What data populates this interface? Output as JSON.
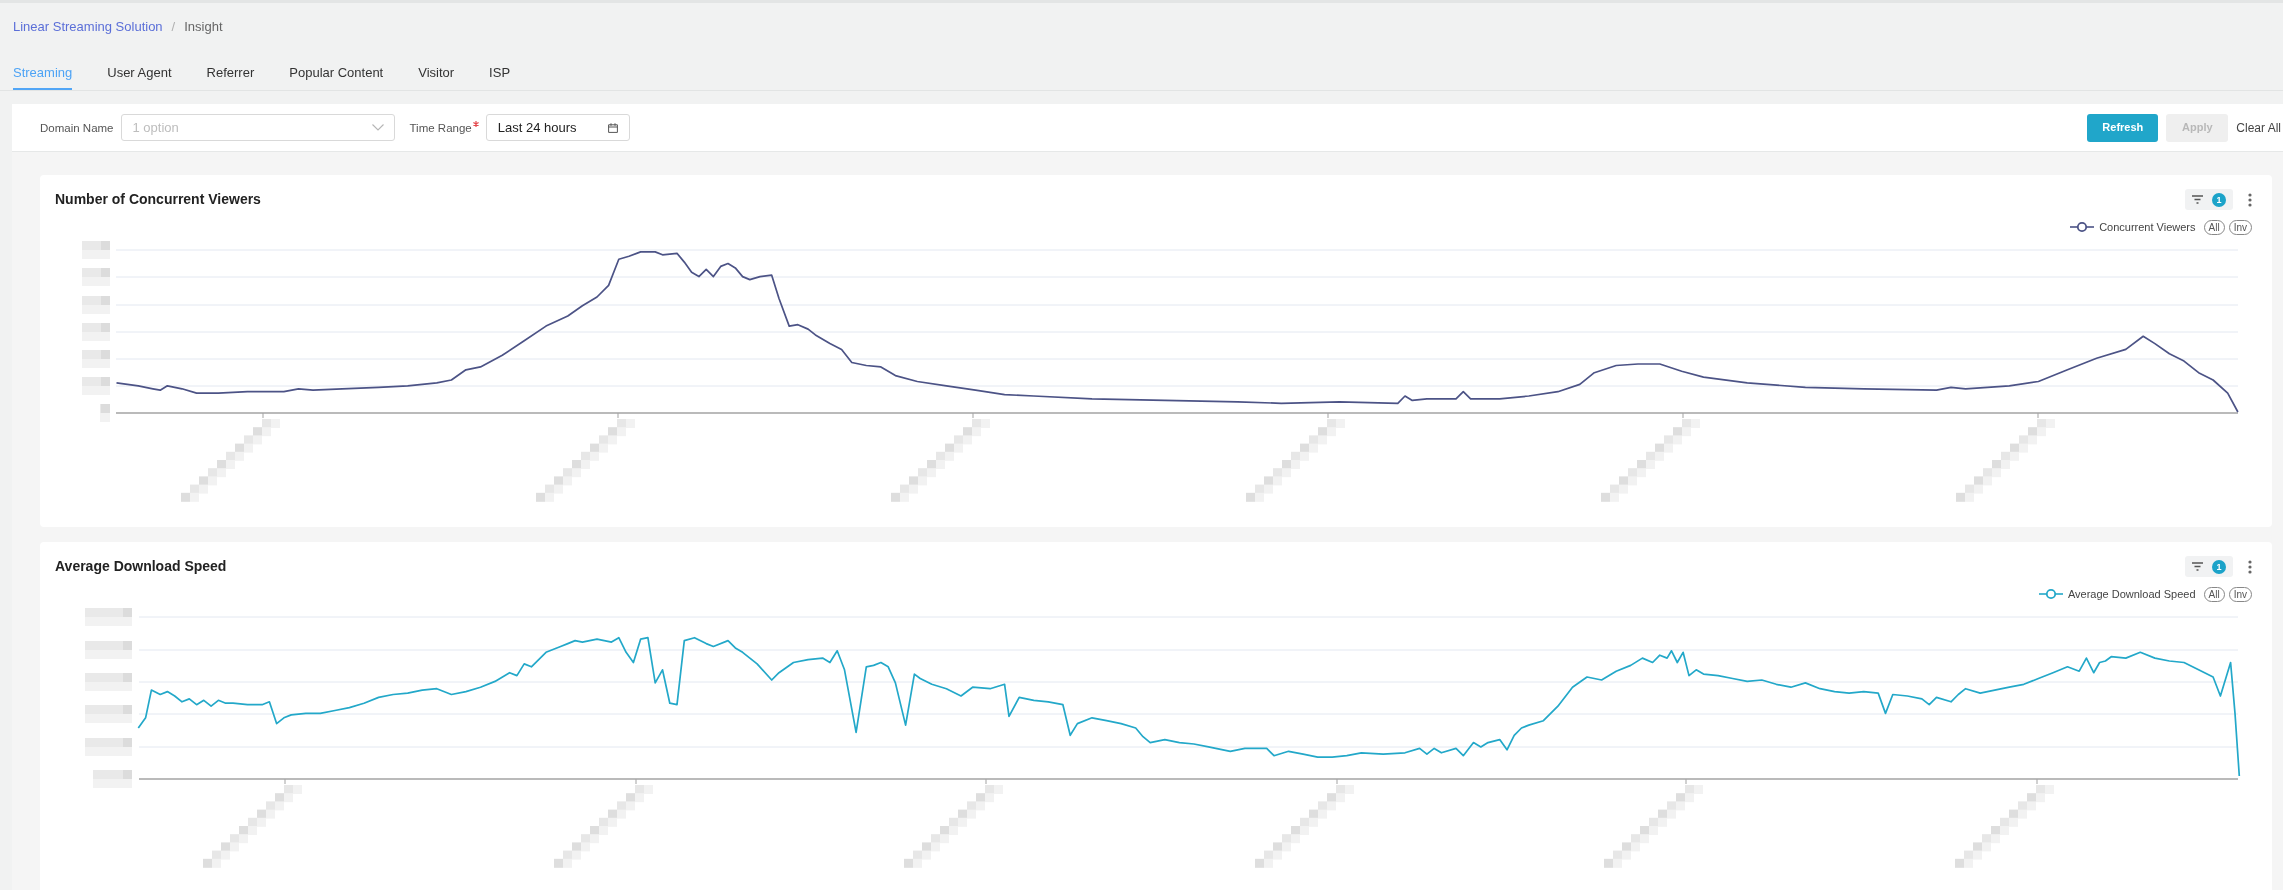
{
  "breadcrumb": {
    "separator": "/",
    "items": [
      {
        "label": "Linear Streaming Solution",
        "link": true
      },
      {
        "label": "Insight",
        "link": false
      }
    ]
  },
  "tabs": [
    {
      "label": "Streaming",
      "selected": true
    },
    {
      "label": "User Agent",
      "selected": false
    },
    {
      "label": "Referrer",
      "selected": false
    },
    {
      "label": "Popular Content",
      "selected": false
    },
    {
      "label": "Visitor",
      "selected": false
    },
    {
      "label": "ISP",
      "selected": false
    }
  ],
  "filters": {
    "fields": [
      {
        "kind": "select",
        "label": "Domain Name",
        "required": false,
        "placeholder": "1 option"
      },
      {
        "kind": "date",
        "label": "Time Range",
        "required": true,
        "value": "Last 24 hours"
      }
    ],
    "buttons": [
      {
        "label": "Refresh",
        "kind": "primary",
        "disabled": false
      },
      {
        "label": "Apply",
        "kind": "default",
        "disabled": true
      },
      {
        "label": "Clear All",
        "kind": "link",
        "disabled": false
      }
    ]
  },
  "charts": [
    {
      "title": "Number of Concurrent Viewers",
      "filter_count": "1",
      "legend": {
        "label": "Concurrent Viewers",
        "color": "#4c5386"
      },
      "legend_buttons": [
        "All",
        "Inv"
      ]
    },
    {
      "title": "Average Download Speed",
      "filter_count": "1",
      "legend": {
        "label": "Average Download Speed",
        "color": "#23a8c9"
      },
      "legend_buttons": [
        "All",
        "Inv"
      ]
    }
  ]
}
